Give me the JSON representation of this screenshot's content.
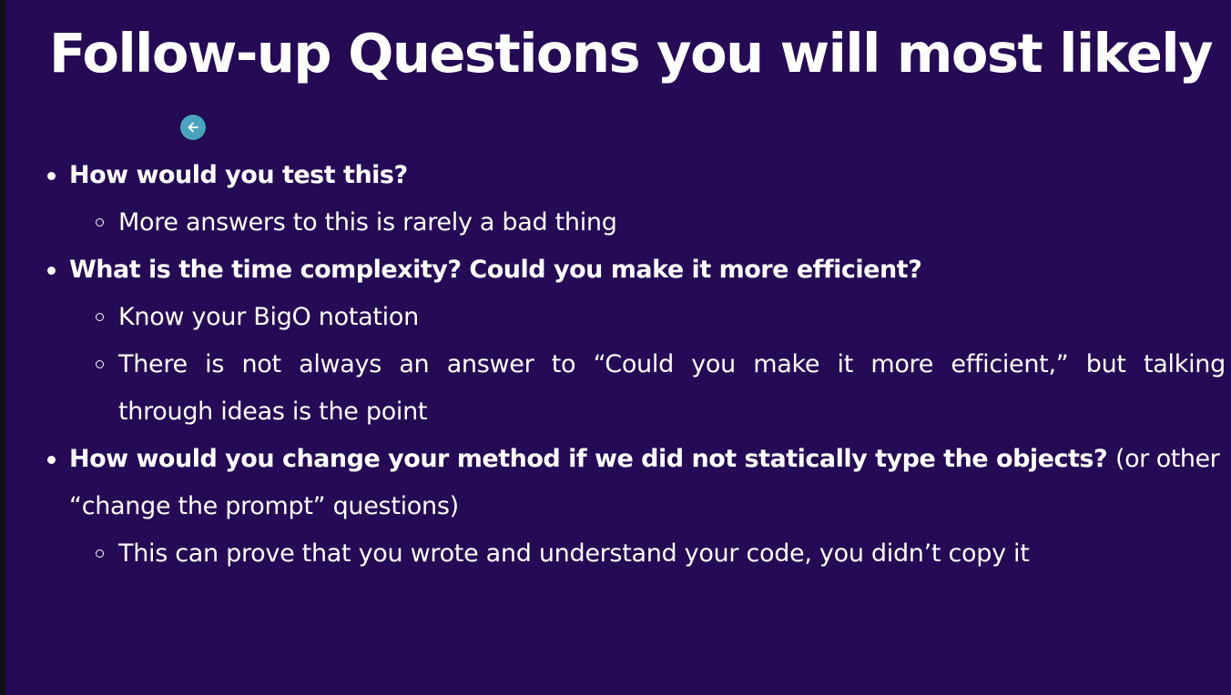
{
  "slide": {
    "title": "Follow-up Questions you will most likely get",
    "cursor_icon": "arrow-left-icon",
    "bullets": [
      {
        "text": "How would you test this?",
        "sub": [
          "More answers to this is rarely a bad thing"
        ]
      },
      {
        "text": "What is the time complexity? Could you make it more efficient?",
        "sub": [
          "Know your BigO notation",
          "There is not always an answer to “Could you make it more efficient,” but talking through ideas is the point"
        ]
      },
      {
        "text": "How would you change your method if we did not statically type the objects?",
        "text_suffix": "(or other “change the prompt” questions)",
        "sub": [
          "This can prove that you wrote and understand your code, you didn’t copy it"
        ]
      }
    ]
  },
  "lines": {
    "b2_sub2_line1_words": [
      "There",
      "is",
      "not",
      "always",
      "an",
      "answer",
      "to",
      "“Could",
      "you",
      "make",
      "it",
      "more",
      "efficient,”",
      "but",
      "talking"
    ],
    "b2_sub2_line2": "through ideas is the point",
    "b3_line1_suffix": "(or other",
    "b3_line2": "“change the prompt” questions)"
  }
}
